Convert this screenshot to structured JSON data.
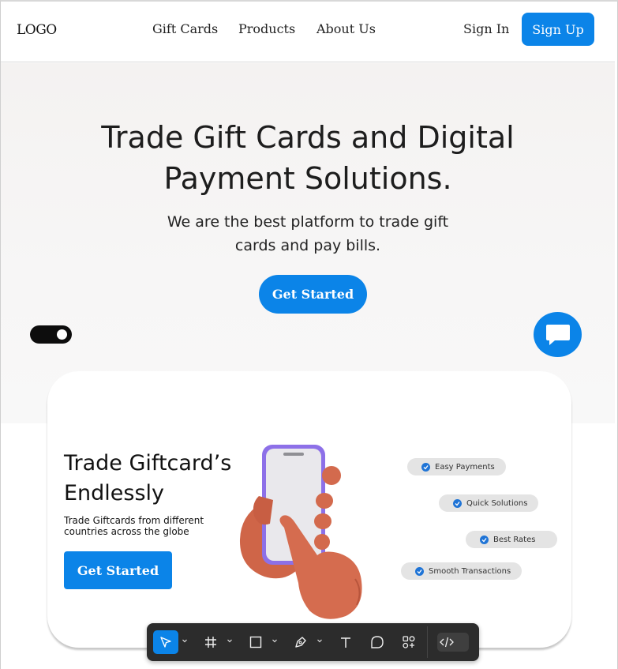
{
  "header": {
    "logo": "LOGO",
    "nav": [
      "Gift Cards",
      "Products",
      "About Us"
    ],
    "sign_in": "Sign In",
    "sign_up": "Sign Up"
  },
  "hero": {
    "title_line1": "Trade Gift Cards and Digital",
    "title_line2": "Payment Solutions.",
    "subtitle_line1": "We are the best platform to trade gift",
    "subtitle_line2": "cards and pay bills.",
    "cta": "Get Started",
    "toggle_on": true,
    "chat_icon": "chat-bubble-icon"
  },
  "card": {
    "title_line1": "Trade Giftcard’s",
    "title_line2": "Endlessly",
    "desc_line1": "Trade Giftcards from different",
    "desc_line2": "countries across the globe",
    "cta": "Get Started",
    "features": [
      "Easy Payments",
      "Quick Solutions",
      "Best Rates",
      "Smooth Transactions"
    ]
  },
  "toolbar": {
    "tools": [
      "move-icon",
      "frame-icon",
      "rectangle-icon",
      "pen-icon",
      "text-icon",
      "comment-icon",
      "components-icon",
      "dev-mode-icon"
    ]
  },
  "colors": {
    "accent": "#0b84e8",
    "toolbar_bg": "#2c2c2c",
    "hand": "#d0674a"
  }
}
